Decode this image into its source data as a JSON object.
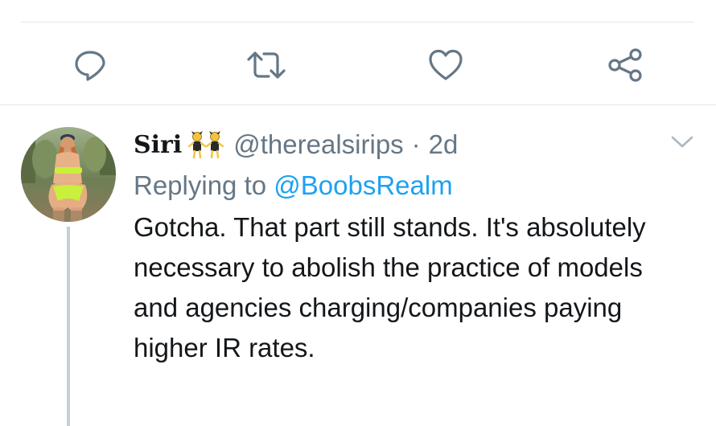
{
  "icons": {
    "reply": "reply-icon",
    "retweet": "retweet-icon",
    "like": "heart-icon",
    "share": "share-icon",
    "caret": "chevron-down-icon",
    "badge": "dancing-people-emoji"
  },
  "colors": {
    "icon": "#657786",
    "link": "#1da1f2",
    "text": "#14171a",
    "divider": "#e1e8ed",
    "thread_line": "#c4cfd6"
  },
  "tweet": {
    "display_name": "Siri",
    "handle": "@therealsirips",
    "separator": "·",
    "time": "2d",
    "replying_prefix": "Replying to",
    "replying_handle": "@BoobsRealm",
    "text": "Gotcha. That part still stands. It's absolutely necessary to abolish the practice of models and agencies charging/companies paying higher IR rates."
  }
}
